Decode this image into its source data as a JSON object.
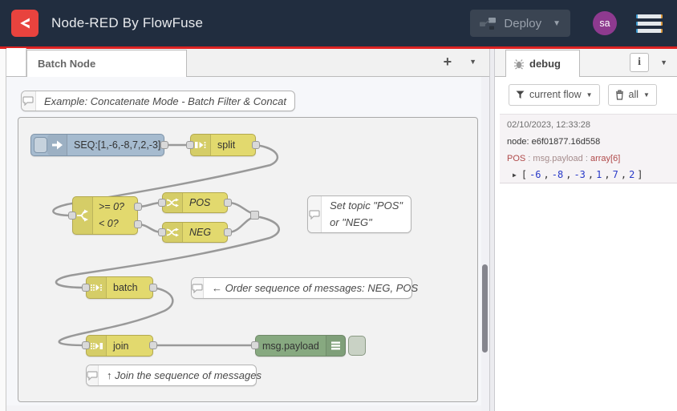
{
  "header": {
    "title": "Node-RED By FlowFuse",
    "deploy": "Deploy",
    "avatar": "sa"
  },
  "tabs": {
    "active": "Batch Node",
    "add": "+"
  },
  "flow": {
    "top_comment": "Example: Concatenate Mode - Batch Filter & Concat",
    "inject_label": "SEQ:[1,-6,-8,7,2,-3]",
    "split_label": "split",
    "switch_rule1": ">= 0?",
    "switch_rule2": "< 0?",
    "pos_label": "POS",
    "neg_label": "NEG",
    "batch_label": "batch",
    "join_label": "join",
    "debug_label": "msg.payload",
    "comment_settopic1": "Set topic \"POS\"",
    "comment_settopic2": "or \"NEG\"",
    "comment_order": "← Order sequence of messages: NEG, POS",
    "comment_join": "↑ Join the sequence of messages"
  },
  "sidebar": {
    "tab": "debug",
    "info": "i",
    "filter": "current flow",
    "clear": "all",
    "message": {
      "timestamp": "02/10/2023, 12:33:28",
      "node": "node: e6f01877.16d558",
      "topic": "POS",
      "sep": " : ",
      "property": "msg.payload",
      "type": "array[6]",
      "open": "[",
      "close": "]",
      "comma": ",",
      "expand": "▶",
      "values": [
        "-6",
        "-8",
        "-3",
        "1",
        "7",
        "2"
      ]
    }
  },
  "icons": {
    "logo": "flowfuse-chevron",
    "deploy": "node-link",
    "menu": "hamburger",
    "inject": "arrow-right",
    "split": "bar-arrow-dots",
    "switch": "fork",
    "change": "shuffle",
    "batch": "dots-arrow-dots",
    "join": "dots-arrow-bar",
    "debug": "lines",
    "comment": "speech-bubble",
    "filter": "funnel",
    "clear": "trash",
    "sidebar_tab": "bug"
  },
  "colors": {
    "accent_red": "#dd2222",
    "header_bg": "#212d3f",
    "node_yellow": "#e2d96e",
    "node_blue": "#a6bbcf",
    "node_green": "#87a980",
    "wire": "#999999",
    "avatar_purple": "#8e3a8f",
    "debug_value_blue": "#2839c8",
    "debug_topic_red": "#b04a4a"
  }
}
